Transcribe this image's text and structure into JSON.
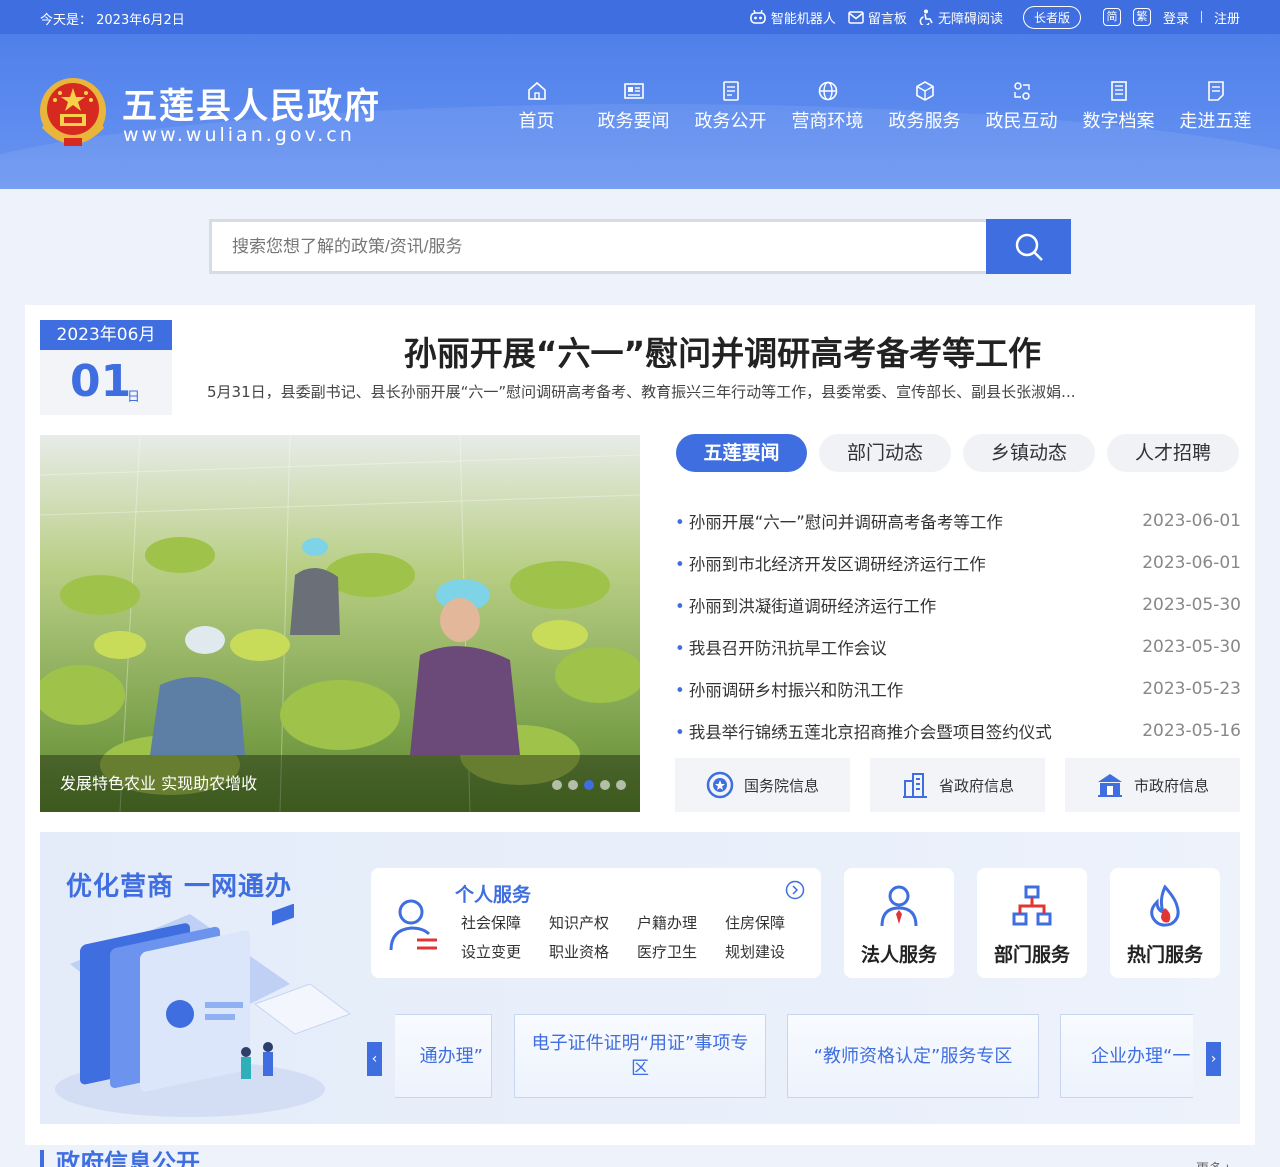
{
  "topbar": {
    "date": "今天是：  2023年6月2日",
    "robot": "智能机器人",
    "guestbook": "留言板",
    "accessible": "无障碍阅读",
    "elder": "长者版",
    "simplified": "简",
    "traditional": "繁",
    "login": "登录",
    "register": "注册"
  },
  "header": {
    "title": "五莲县人民政府",
    "domain": "www.wulian.gov.cn",
    "nav": [
      "首页",
      "政务要闻",
      "政务公开",
      "营商环境",
      "政务服务",
      "政民互动",
      "数字档案",
      "走进五莲"
    ]
  },
  "search": {
    "placeholder": "搜索您想了解的政策/资讯/服务"
  },
  "feature": {
    "year_month": "2023年06月",
    "day": "01",
    "day_unit": "日",
    "headline": "孙丽开展“六一”慰问并调研高考备考等工作",
    "summary": "5月31日，县委副书记、县长孙丽开展“六一”慰问调研高考备考、教育振兴三年行动等工作，县委常委、宣传部长、副县长张淑娟..."
  },
  "photo": {
    "caption": "发展特色农业 实现助农增收"
  },
  "tabs": [
    "五莲要闻",
    "部门动态",
    "乡镇动态",
    "人才招聘"
  ],
  "news": [
    {
      "title": "孙丽开展“六一”慰问并调研高考备考等工作",
      "date": "2023-06-01"
    },
    {
      "title": "孙丽到市北经济开发区调研经济运行工作",
      "date": "2023-06-01"
    },
    {
      "title": "孙丽到洪凝街道调研经济运行工作",
      "date": "2023-05-30"
    },
    {
      "title": "我县召开防汛抗旱工作会议",
      "date": "2023-05-30"
    },
    {
      "title": "孙丽调研乡村振兴和防汛工作",
      "date": "2023-05-23"
    },
    {
      "title": "我县举行锦绣五莲北京招商推介会暨项目签约仪式",
      "date": "2023-05-16"
    }
  ],
  "gov_links": [
    "国务院信息",
    "省政府信息",
    "市政府信息"
  ],
  "services": {
    "title": "优化营商  一网通办",
    "personal_title": "个人服务",
    "personal_items": [
      "社会保障",
      "知识产权",
      "户籍办理",
      "住房保障",
      "设立变更",
      "职业资格",
      "医疗卫生",
      "规划建设"
    ],
    "cards": [
      "法人服务",
      "部门服务",
      "热门服务"
    ],
    "slides": [
      "通办理”",
      "电子证件证明“用证”事项专区",
      "“教师资格认定”服务专区",
      "企业办理“一"
    ]
  },
  "section": {
    "title": "政府信息公开",
    "more": "更多+"
  },
  "colors": {
    "primary": "#3f6ee0"
  }
}
